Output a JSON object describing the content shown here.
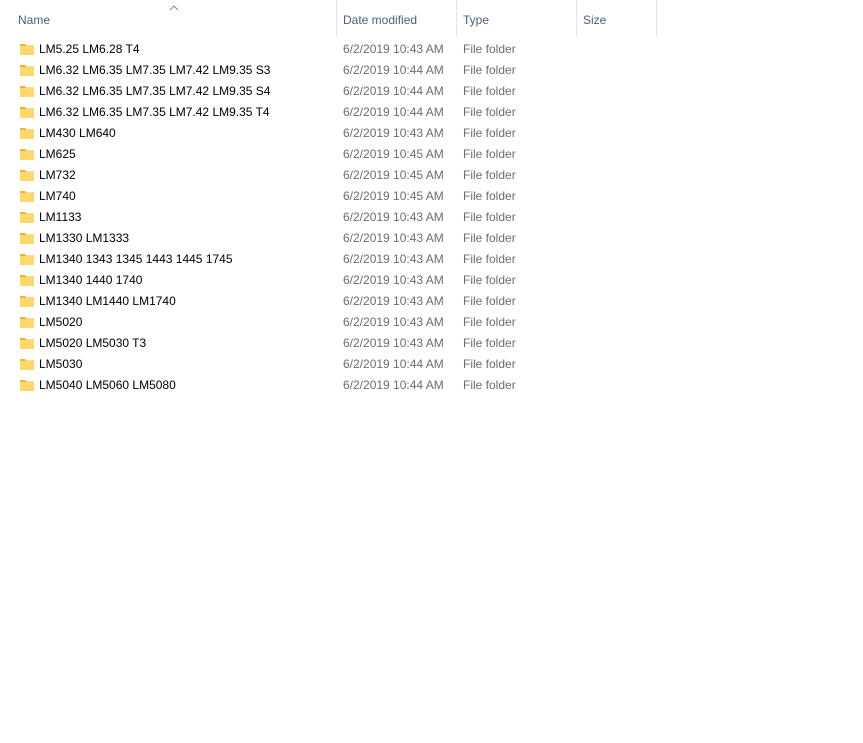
{
  "columns": {
    "name": "Name",
    "date_modified": "Date modified",
    "type": "Type",
    "size": "Size"
  },
  "sort": {
    "column": "name",
    "direction": "ascending",
    "icon": "chevron-up-icon"
  },
  "files": [
    {
      "name": "LM5.25 LM6.28 T4",
      "date": "6/2/2019 10:43 AM",
      "type": "File folder",
      "size": ""
    },
    {
      "name": "LM6.32 LM6.35 LM7.35 LM7.42 LM9.35 S3",
      "date": "6/2/2019 10:44 AM",
      "type": "File folder",
      "size": ""
    },
    {
      "name": "LM6.32 LM6.35 LM7.35 LM7.42 LM9.35 S4",
      "date": "6/2/2019 10:44 AM",
      "type": "File folder",
      "size": ""
    },
    {
      "name": "LM6.32 LM6.35 LM7.35 LM7.42 LM9.35 T4",
      "date": "6/2/2019 10:44 AM",
      "type": "File folder",
      "size": ""
    },
    {
      "name": "LM430 LM640",
      "date": "6/2/2019 10:43 AM",
      "type": "File folder",
      "size": ""
    },
    {
      "name": "LM625",
      "date": "6/2/2019 10:45 AM",
      "type": "File folder",
      "size": ""
    },
    {
      "name": "LM732",
      "date": "6/2/2019 10:45 AM",
      "type": "File folder",
      "size": ""
    },
    {
      "name": "LM740",
      "date": "6/2/2019 10:45 AM",
      "type": "File folder",
      "size": ""
    },
    {
      "name": "LM1133",
      "date": "6/2/2019 10:43 AM",
      "type": "File folder",
      "size": ""
    },
    {
      "name": "LM1330 LM1333",
      "date": "6/2/2019 10:43 AM",
      "type": "File folder",
      "size": ""
    },
    {
      "name": "LM1340 1343 1345 1443 1445 1745",
      "date": "6/2/2019 10:43 AM",
      "type": "File folder",
      "size": ""
    },
    {
      "name": "LM1340 1440 1740",
      "date": "6/2/2019 10:43 AM",
      "type": "File folder",
      "size": ""
    },
    {
      "name": "LM1340 LM1440 LM1740",
      "date": "6/2/2019 10:43 AM",
      "type": "File folder",
      "size": ""
    },
    {
      "name": "LM5020",
      "date": "6/2/2019 10:43 AM",
      "type": "File folder",
      "size": ""
    },
    {
      "name": "LM5020 LM5030 T3",
      "date": "6/2/2019 10:43 AM",
      "type": "File folder",
      "size": ""
    },
    {
      "name": "LM5030",
      "date": "6/2/2019 10:44 AM",
      "type": "File folder",
      "size": ""
    },
    {
      "name": "LM5040 LM5060 LM5080",
      "date": "6/2/2019 10:44 AM",
      "type": "File folder",
      "size": ""
    }
  ],
  "colors": {
    "header_text": "#4c607a",
    "secondary_text": "#6d6d6d",
    "folder_fill": "#ffd86b",
    "folder_tab": "#e8b43c"
  },
  "icons": {
    "folder": "folder-icon"
  }
}
